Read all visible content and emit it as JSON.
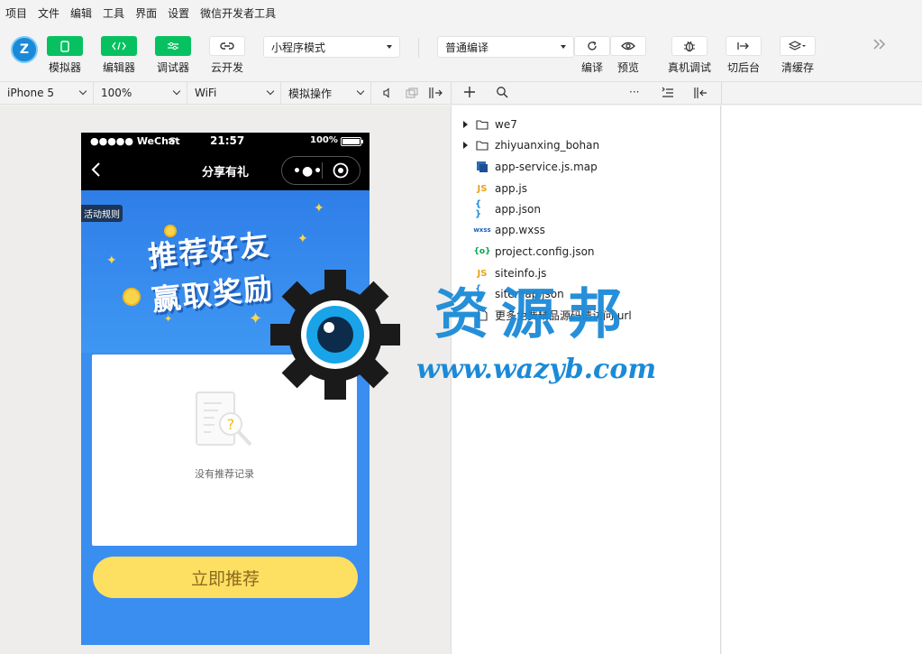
{
  "menu": [
    "项目",
    "文件",
    "编辑",
    "工具",
    "界面",
    "设置",
    "微信开发者工具"
  ],
  "toolbar": {
    "simulator": "模拟器",
    "editor": "编辑器",
    "debugger": "调试器",
    "cloud": "云开发",
    "mode_select": "小程序模式",
    "compile_select": "普通编译",
    "compile": "编译",
    "preview": "预览",
    "remote_debug": "真机调试",
    "background": "切后台",
    "clear_cache": "清缓存"
  },
  "subbar": {
    "device": "iPhone 5",
    "zoom": "100%",
    "network": "WiFi",
    "operation": "模拟操作"
  },
  "phone": {
    "carrier": "●●●●● WeChat",
    "time": "21:57",
    "battery": "100%",
    "page_title": "分享有礼",
    "rules_tag": "活动规则",
    "banner_line1": "推荐好友",
    "banner_line2": "赢取奖励",
    "empty_text": "没有推荐记录",
    "cta": "立即推荐"
  },
  "files": [
    {
      "name": "we7",
      "type": "folder"
    },
    {
      "name": "zhiyuanxing_bohan",
      "type": "folder"
    },
    {
      "name": "app-service.js.map",
      "type": "map"
    },
    {
      "name": "app.js",
      "type": "js"
    },
    {
      "name": "app.json",
      "type": "json"
    },
    {
      "name": "app.wxss",
      "type": "wxss"
    },
    {
      "name": "project.config.json",
      "type": "config"
    },
    {
      "name": "siteinfo.js",
      "type": "js"
    },
    {
      "name": "sitemap.json",
      "type": "json"
    },
    {
      "name": "更多免费精品源码请访问.url",
      "type": "file"
    }
  ],
  "watermark": {
    "title": "资源邦",
    "url": "www.wazyb.com"
  },
  "colors": {
    "accent": "#07c160",
    "phone_bg": "#3a8ef0",
    "cta": "#fddf62",
    "js_icon": "#e8a317",
    "json_icon": "#1f8ad8"
  }
}
